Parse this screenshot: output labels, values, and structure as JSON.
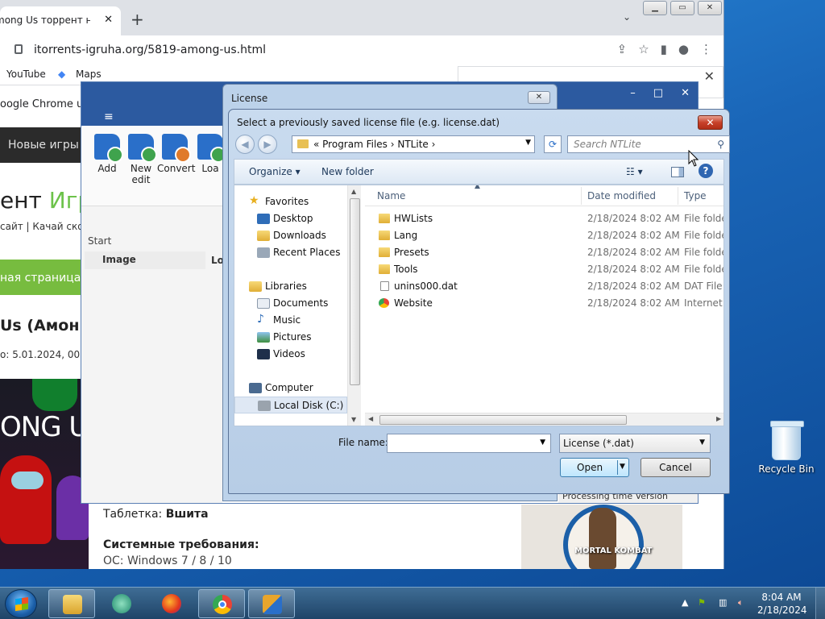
{
  "desktop": {
    "recycle_bin_label": "Recycle Bin"
  },
  "chrome": {
    "tab_title": "mong Us торрент на П",
    "tab_close": "✕",
    "new_tab": "+",
    "tab_menu": "⌄",
    "url": "itorrents-igruha.org/5819-among-us.html",
    "bookmarks": [
      "YouTube",
      "Maps"
    ],
    "infobar_text": "oogle Chrome up",
    "panel_close": "✕",
    "site": {
      "nav_item": "Новые игры",
      "title_left": "ент ",
      "title_green": "Игр",
      "subtitle": "сайт | Качай скол",
      "green_button": "ная страница",
      "game_heading": "Us (Амонг",
      "date_line": "о: 5.01.2024, 00:",
      "art_text": "ONG US",
      "tablet_label": "Таблетка: ",
      "tablet_value": "Вшита",
      "sysreq_heading": "Системные требования:",
      "os_line": "ОС: Windows 7 / 8 / 10",
      "mk_label": "MORTAL KOMBAT"
    }
  },
  "ntlite": {
    "menu_icon": "≡",
    "ribbon": [
      {
        "label": "Add"
      },
      {
        "label": "New edit"
      },
      {
        "label": "Convert"
      },
      {
        "label": "Loa"
      }
    ],
    "start_label": "Start",
    "image_col": "Image",
    "lo_col": "Lo",
    "bottom_cols": "Processing time    Version"
  },
  "license_dialog": {
    "title": "License",
    "close": "✕"
  },
  "open_dialog": {
    "title": "Select a previously saved license file (e.g. license.dat)",
    "close": "✕",
    "path": "« Program Files › NTLite ›",
    "search_placeholder": "Search NTLite",
    "organize": "Organize ▾",
    "new_folder": "New folder",
    "nav": {
      "favorites": "Favorites",
      "desktop": "Desktop",
      "downloads": "Downloads",
      "recent": "Recent Places",
      "libraries": "Libraries",
      "documents": "Documents",
      "music": "Music",
      "pictures": "Pictures",
      "videos": "Videos",
      "computer": "Computer",
      "local_disk": "Local Disk (C:)"
    },
    "columns": {
      "name": "Name",
      "date": "Date modified",
      "type": "Type"
    },
    "files": [
      {
        "name": "HWLists",
        "date": "2/18/2024 8:02 AM",
        "type": "File folder"
      },
      {
        "name": "Lang",
        "date": "2/18/2024 8:02 AM",
        "type": "File folder"
      },
      {
        "name": "Presets",
        "date": "2/18/2024 8:02 AM",
        "type": "File folder"
      },
      {
        "name": "Tools",
        "date": "2/18/2024 8:02 AM",
        "type": "File folder"
      },
      {
        "name": "unins000.dat",
        "date": "2/18/2024 8:02 AM",
        "type": "DAT File"
      },
      {
        "name": "Website",
        "date": "2/18/2024 8:02 AM",
        "type": "Internet S"
      }
    ],
    "file_name_label": "File name:",
    "file_name_value": "",
    "filter": "License (*.dat)",
    "open": "Open",
    "cancel": "Cancel"
  },
  "taskbar": {
    "clock_time": "8:04 AM",
    "clock_date": "2/18/2024"
  }
}
